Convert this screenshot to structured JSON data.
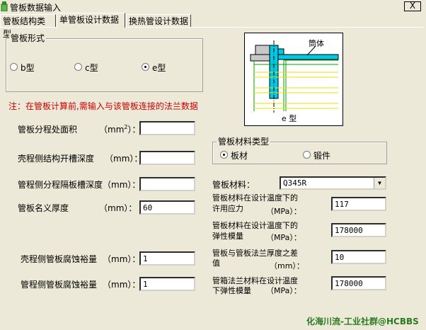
{
  "window": {
    "title": "管板数据输入",
    "close_label": "X"
  },
  "tabs": [
    {
      "label": "管板结构类型"
    },
    {
      "label": "单管板设计数据"
    },
    {
      "label": "换热管设计数据"
    }
  ],
  "tubesheet_form": {
    "legend": "管板形式",
    "options": [
      {
        "label": "b型",
        "checked": false
      },
      {
        "label": "c型",
        "checked": false
      },
      {
        "label": "e型",
        "checked": true
      }
    ]
  },
  "diagram": {
    "shell_label": "筒体",
    "caption": "e 型"
  },
  "note": "注：在管板计算前,需输入与该管板连接的法兰数据",
  "left_fields": [
    {
      "label": "管板分程处面积",
      "unit_prefix": "（mm",
      "unit_sup": "2",
      "unit_suffix": "）：",
      "value": ""
    },
    {
      "label": "壳程侧结构开槽深度",
      "unit": "（mm）：",
      "value": ""
    },
    {
      "label": "管程侧分程隔板槽深度（mm）：",
      "value": ""
    },
    {
      "label": "管板名义厚度",
      "unit": "（mm）：",
      "value": "60"
    },
    {
      "label": "壳程侧管板腐蚀裕量",
      "unit": "（mm）：",
      "value": "1"
    },
    {
      "label": "管程侧管板腐蚀裕量",
      "unit": "（mm）：",
      "value": "1"
    }
  ],
  "material_type": {
    "legend": "管板材料类型",
    "options": [
      {
        "label": "板材",
        "checked": true
      },
      {
        "label": "锻件",
        "checked": false
      }
    ]
  },
  "material": {
    "label": "管板材料：",
    "selected": "Q345R"
  },
  "right_fields": [
    {
      "line1": "管板材料在设计温度下的",
      "line2": "许用应力",
      "unit": "（MPa）：",
      "value": "117"
    },
    {
      "line1": "管板材料在设计温度下的",
      "line2": "弹性模量",
      "unit": "（MPa）：",
      "value": "178000"
    },
    {
      "line1": "管板与管板法兰厚度之差",
      "line2": "值",
      "unit": "（mm）：",
      "value": "10"
    },
    {
      "line1": "管箱法兰材料在设计温度",
      "line2": "下弹性模量",
      "unit": "（MPa）：",
      "value": "178000"
    }
  ],
  "watermark": "化海川流-工业社群@HCBBS",
  "colors": {
    "window_bg": "#ece9d8",
    "note_red": "#cc0000",
    "watermark_green": "#2b7a1f",
    "diagram_cyan": "#00c8e6",
    "diagram_yellow": "#ffff00",
    "diagram_green": "#00a000"
  }
}
